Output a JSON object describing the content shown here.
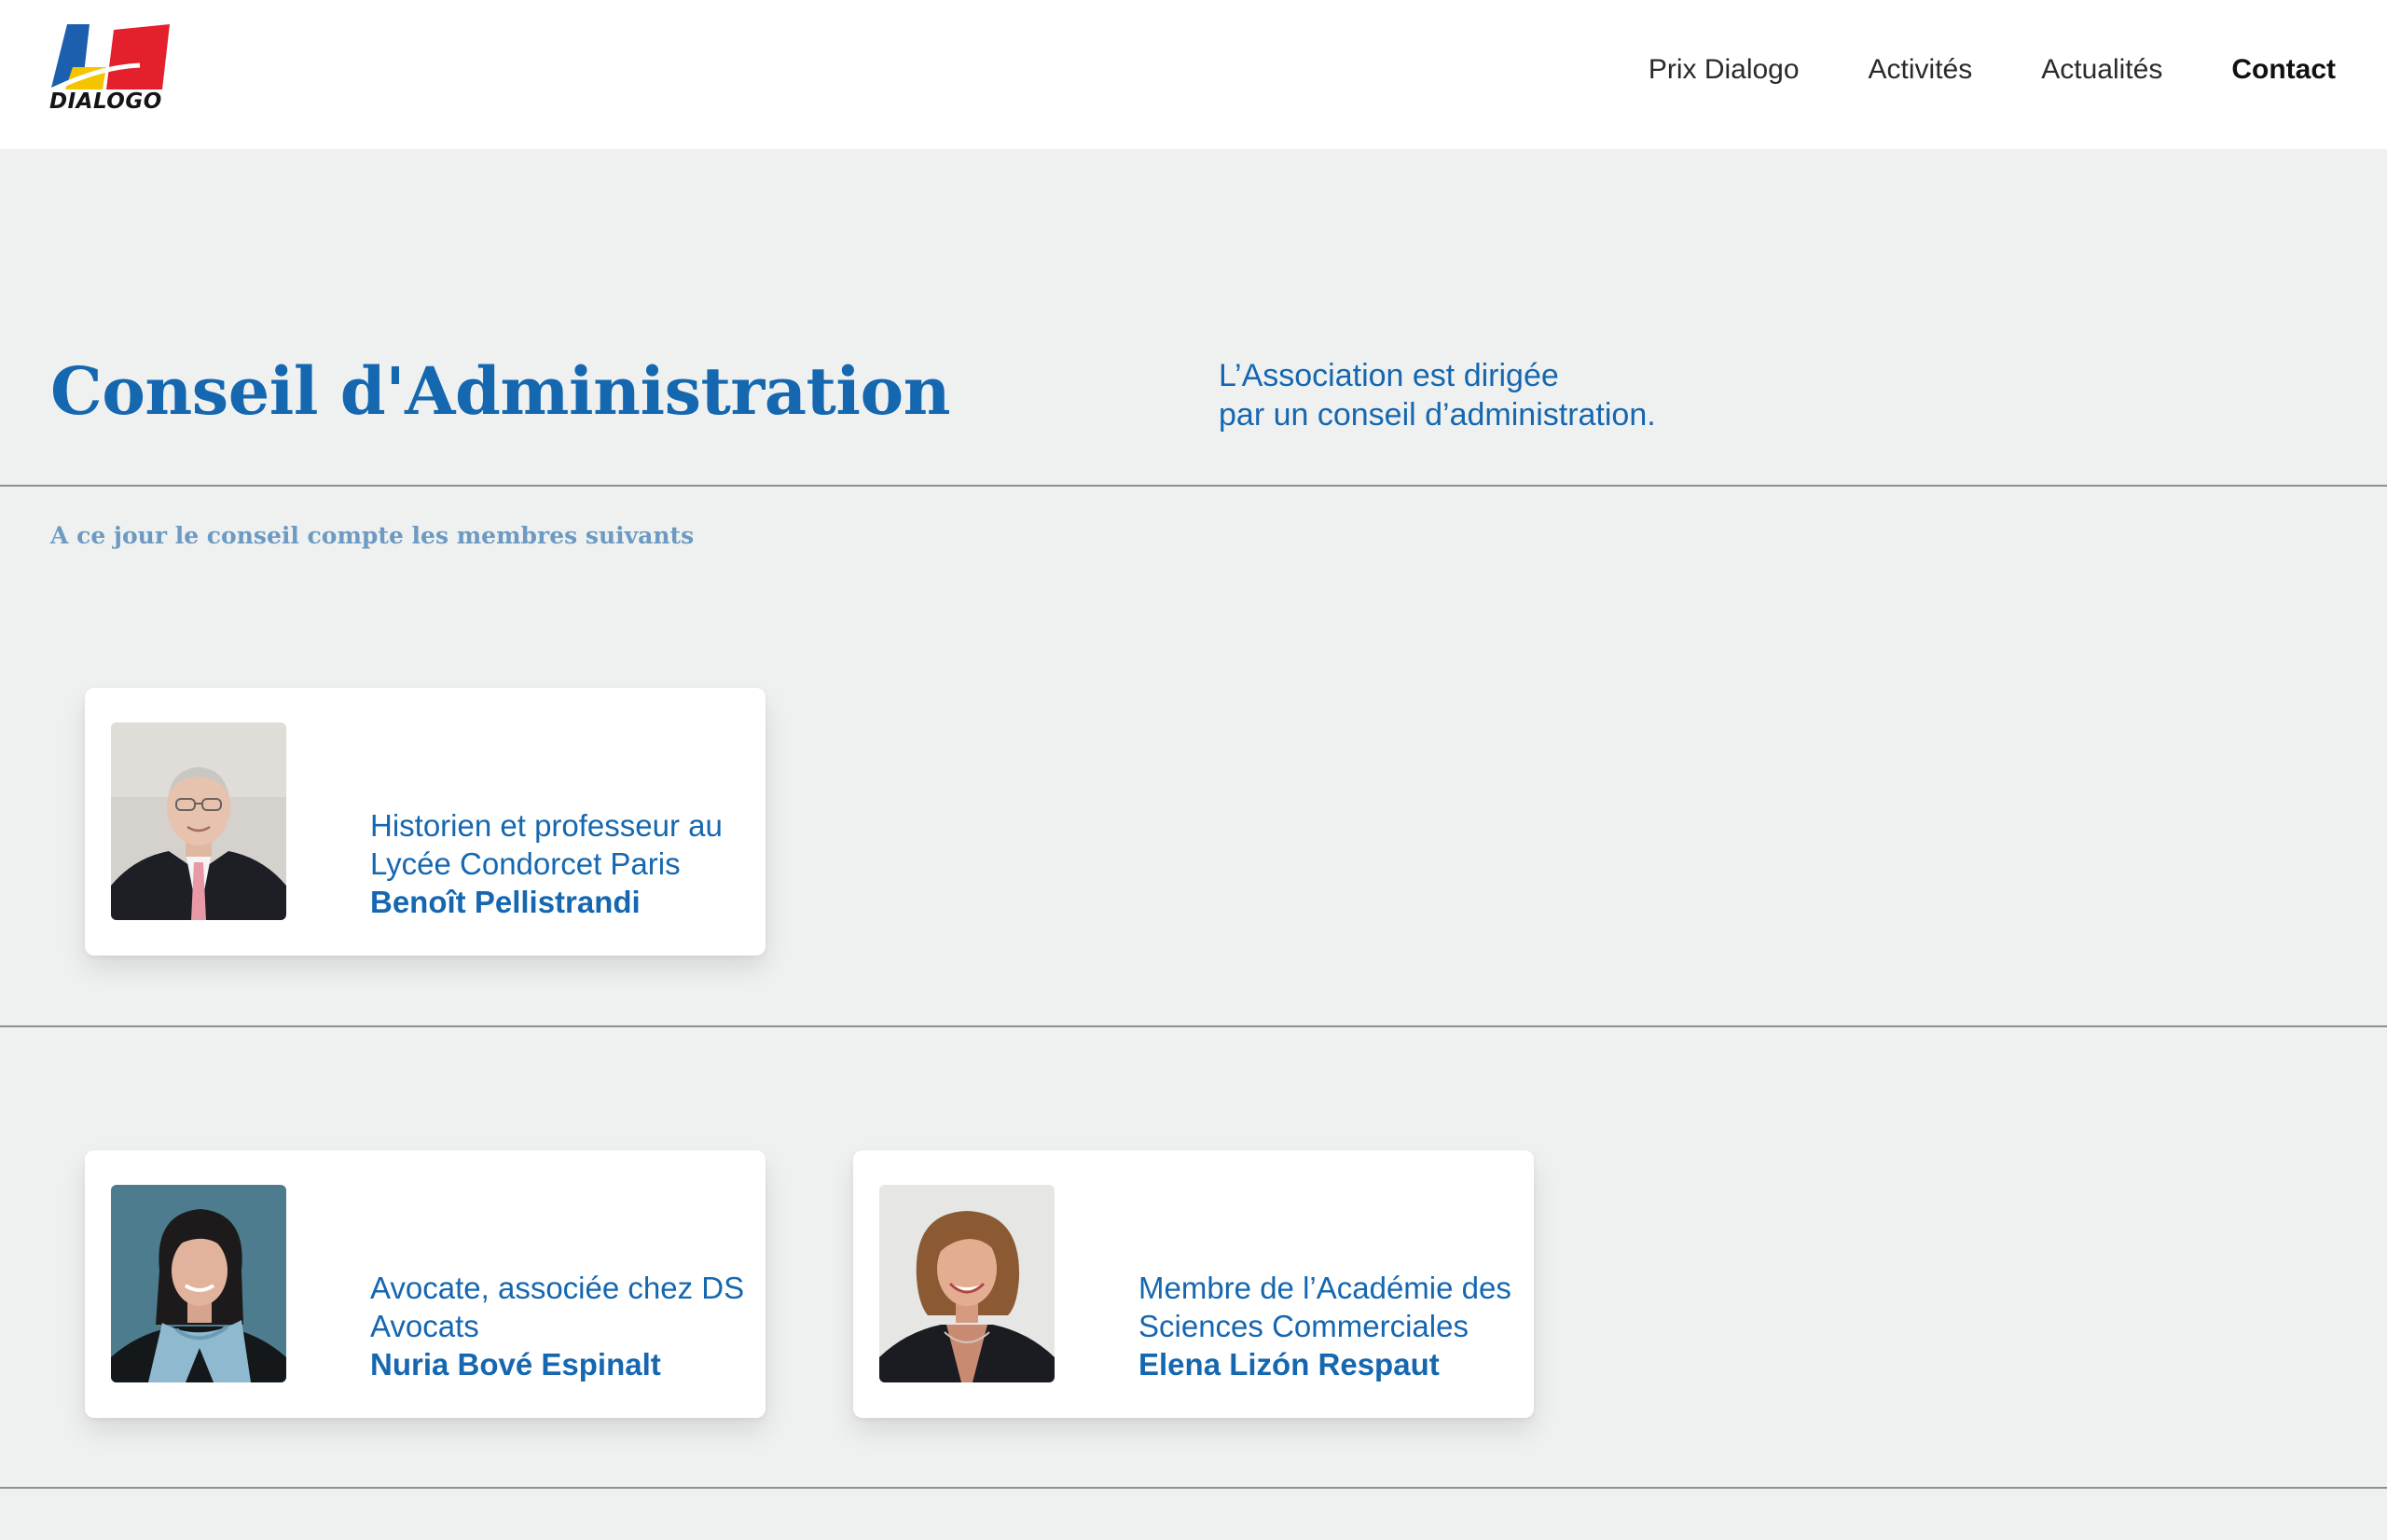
{
  "brand": {
    "name": "DIALOGO",
    "colors": {
      "blue": "#1b5fae",
      "yellow": "#f5c400",
      "red": "#e3202b"
    }
  },
  "nav": {
    "items": [
      {
        "label": "Prix Dialogo",
        "active": false
      },
      {
        "label": "Activités",
        "active": false
      },
      {
        "label": "Actualités",
        "active": false
      },
      {
        "label": "Contact",
        "active": true
      }
    ]
  },
  "page": {
    "title": "Conseil d'Administration",
    "intro": [
      "L’Association est dirigée",
      "par un conseil d’administration."
    ],
    "subtitle": "A ce jour le conseil compte les membres suivants"
  },
  "members": [
    {
      "role": "Historien et professeur au Lycée Condorcet Paris",
      "name": "Benoît Pellistrandi",
      "photo": "portrait-man-glasses"
    },
    {
      "role": "Avocate, associée chez DS Avocats",
      "name": "Nuria Bové Espinalt",
      "photo": "portrait-woman-scarf"
    },
    {
      "role": "Membre de l’Académie des Sciences Commerciales",
      "name": "Elena Lizón Respaut",
      "photo": "portrait-woman-smiling"
    }
  ],
  "theme": {
    "accent": "#1567b0",
    "background": "#eff1f0",
    "divider": "#8d8f92"
  }
}
